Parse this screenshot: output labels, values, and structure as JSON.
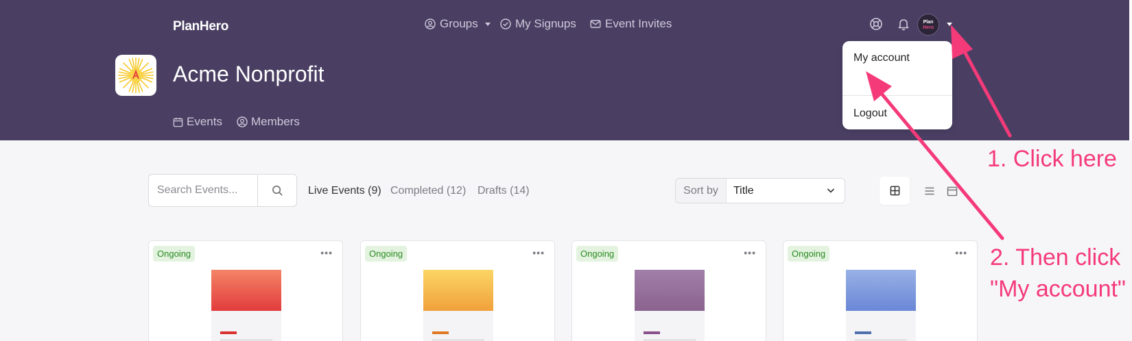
{
  "header": {
    "brand": "PlanHero",
    "nav": {
      "groups": "Groups",
      "my_signups": "My Signups",
      "event_invites": "Event Invites"
    },
    "avatar": {
      "line1": "Plan",
      "line2": "Hero"
    },
    "org_title": "Acme Nonprofit",
    "subnav": {
      "events": "Events",
      "members": "Members"
    }
  },
  "dropdown": {
    "my_account": "My account",
    "logout": "Logout"
  },
  "toolbar": {
    "search_placeholder": "Search Events...",
    "tabs": [
      "Live Events (9)",
      "Completed (12)",
      "Drafts (14)"
    ],
    "sort_label": "Sort by",
    "sort_value": "Title"
  },
  "cards": [
    {
      "badge": "Ongoing",
      "more": "•••",
      "gradient": [
        "#f48467",
        "#e23c3c"
      ],
      "accent": "#d8322f"
    },
    {
      "badge": "Ongoing",
      "more": "•••",
      "gradient": [
        "#fbd565",
        "#f0a13b"
      ],
      "accent": "#e07a26"
    },
    {
      "badge": "Ongoing",
      "more": "•••",
      "gradient": [
        "#a17fa8",
        "#8a638e"
      ],
      "accent": "#8a4f8c"
    },
    {
      "badge": "Ongoing",
      "more": "•••",
      "gradient": [
        "#98b1e6",
        "#6a87d6"
      ],
      "accent": "#4f6fae"
    }
  ],
  "annotations": {
    "step1": "1. Click here",
    "step2_line1": "2. Then click",
    "step2_line2": "\"My account\""
  },
  "colors": {
    "header_bg": "#4a3f63",
    "annotation": "#f53a7a",
    "badge_green": "#2a8a22"
  }
}
